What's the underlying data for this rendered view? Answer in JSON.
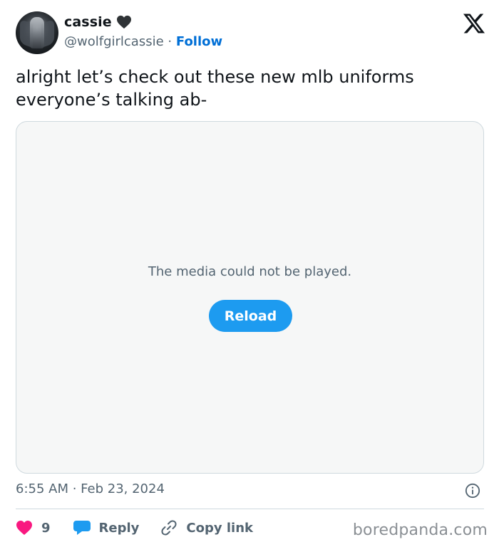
{
  "author": {
    "display_name": "cassie",
    "handle": "@wolfgirlcassie",
    "separator": "·",
    "follow_label": "Follow"
  },
  "tweet": {
    "text": "alright let’s check out these new mlb uniforms everyone’s talking ab-"
  },
  "media": {
    "error_message": "The media could not be played.",
    "reload_label": "Reload"
  },
  "meta": {
    "timestamp": "6:55 AM · Feb 23, 2024"
  },
  "actions": {
    "like_count": "9",
    "reply_label": "Reply",
    "copy_link_label": "Copy link"
  },
  "watermark": "boredpanda.com",
  "colors": {
    "accent": "#1d9bf0",
    "follow": "#006fd6",
    "like": "#f91880",
    "secondary_text": "#536471"
  },
  "icons": [
    "black-heart-icon",
    "x-logo-icon",
    "info-icon",
    "like-heart-icon",
    "reply-bubble-icon",
    "link-icon"
  ]
}
